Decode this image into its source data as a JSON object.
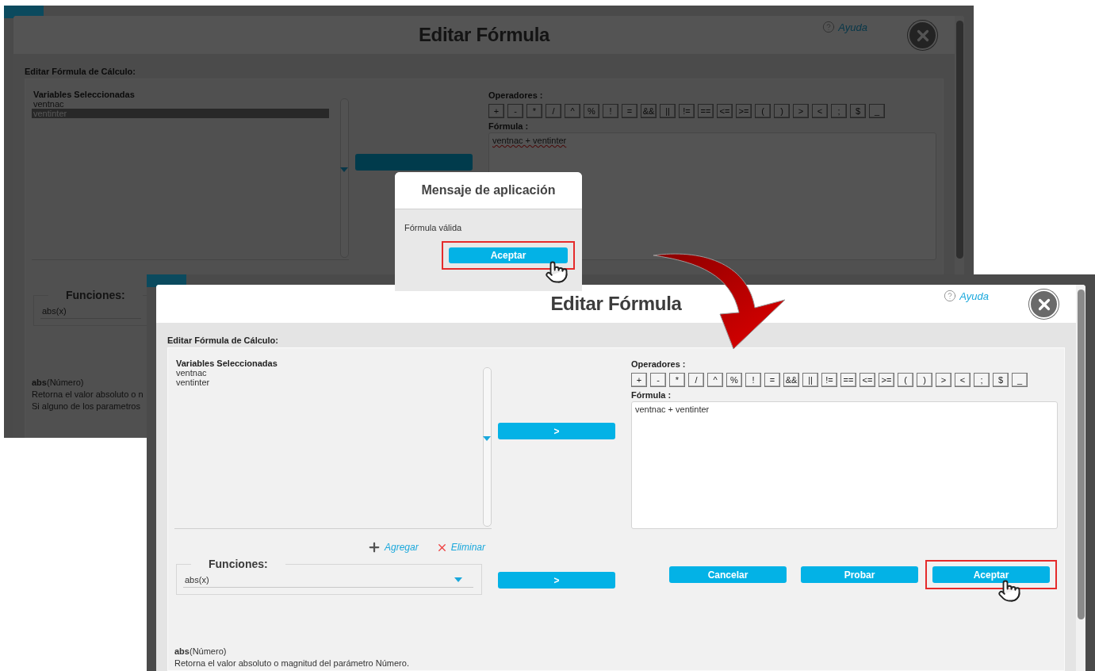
{
  "back_screen": {
    "window": {
      "title": "Editar Fórmula",
      "help": "Ayuda",
      "section_label": "Editar Fórmula de Cálculo:",
      "variables": {
        "header": "Variables Seleccionadas",
        "items": [
          {
            "label": "ventnac",
            "selected": false
          },
          {
            "label": "ventinter",
            "selected": true
          }
        ]
      },
      "functions": {
        "legend": "Funciones:",
        "value": "abs(x)"
      },
      "operators_label": "Operadores :",
      "operators": [
        "+",
        "-",
        "*",
        "/",
        "^",
        "%",
        "!",
        "=",
        "&&",
        "||",
        "!=",
        "==",
        "<=",
        ">=",
        "(",
        ")",
        ">",
        "<",
        ";",
        "$",
        "_"
      ],
      "formula_label": "Fórmula :",
      "formula": "ventnac + ventinter",
      "description": [
        "**abs**(Número)",
        "Retorna el valor absoluto o n",
        "Si alguno de los parametros"
      ]
    },
    "dialog": {
      "title": "Mensaje de aplicación",
      "message": "Fórmula válida",
      "button": {
        "label": "Aceptar",
        "highlighted": true
      }
    }
  },
  "front_screen": {
    "window": {
      "title": "Editar Fórmula",
      "help": "Ayuda",
      "section_label": "Editar Fórmula de Cálculo:",
      "variables": {
        "header": "Variables Seleccionadas",
        "items": [
          {
            "label": "ventnac",
            "selected": false
          },
          {
            "label": "ventinter",
            "selected": false
          }
        ]
      },
      "add_link": "Agregar",
      "remove_link": "Eliminar",
      "move_button": ">",
      "functions": {
        "legend": "Funciones:",
        "value": "abs(x)"
      },
      "insert_button": ">",
      "operators_label": "Operadores :",
      "operators": [
        "+",
        "-",
        "*",
        "/",
        "^",
        "%",
        "!",
        "=",
        "&&",
        "||",
        "!=",
        "==",
        "<=",
        ">=",
        "(",
        ")",
        ">",
        "<",
        ";",
        "$",
        "_"
      ],
      "formula_label": "Fórmula :",
      "formula": "ventnac + ventinter",
      "buttons": [
        {
          "label": "Cancelar",
          "highlighted": false
        },
        {
          "label": "Probar",
          "highlighted": false
        },
        {
          "label": "Aceptar",
          "highlighted": true
        }
      ],
      "description": [
        "**abs**(Número)",
        "Retorna el valor absoluto o magnitud del parámetro Número."
      ]
    }
  }
}
